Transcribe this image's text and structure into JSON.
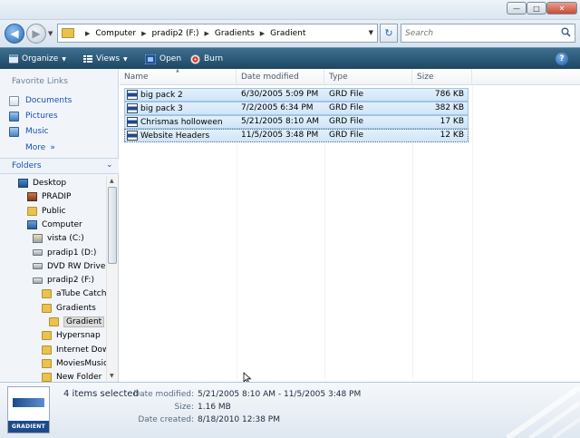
{
  "address": {
    "crumbs": [
      "Computer",
      "pradip2 (F:)",
      "Gradients",
      "Gradient"
    ],
    "search_placeholder": "Search"
  },
  "toolbar": {
    "organize_label": "Organize",
    "views_label": "Views",
    "open_label": "Open",
    "burn_label": "Burn"
  },
  "nav": {
    "favorite_heading": "Favorite Links",
    "favorites": [
      "Documents",
      "Pictures",
      "Music"
    ],
    "more_label": "More",
    "folders_heading": "Folders",
    "tree": [
      {
        "label": "Desktop",
        "icon": "desktop-icon"
      },
      {
        "label": "PRADIP",
        "icon": "user-folder-icon"
      },
      {
        "label": "Public",
        "icon": "folder-icon"
      },
      {
        "label": "Computer",
        "icon": "computer-icon"
      },
      {
        "label": "vista (C:)",
        "icon": "drive-icon"
      },
      {
        "label": "pradip1 (D:)",
        "icon": "drive-icon"
      },
      {
        "label": "DVD RW Drive",
        "icon": "dvd-drive-icon"
      },
      {
        "label": "pradip2 (F:)",
        "icon": "drive-icon"
      },
      {
        "label": "aTube Catch",
        "icon": "folder-icon"
      },
      {
        "label": "Gradients",
        "icon": "folder-icon"
      },
      {
        "label": "Gradient",
        "icon": "folder-icon",
        "selected": true
      },
      {
        "label": "Hypersnap",
        "icon": "folder-icon"
      },
      {
        "label": "Internet Dow",
        "icon": "folder-icon"
      },
      {
        "label": "MoviesMusic",
        "icon": "folder-icon"
      },
      {
        "label": "New Folder",
        "icon": "folder-icon"
      }
    ]
  },
  "columns": {
    "name": "Name",
    "date": "Date modified",
    "type": "Type",
    "size": "Size"
  },
  "files": [
    {
      "name": "big pack 2",
      "date": "6/30/2005 5:09 PM",
      "type": "GRD File",
      "size": "786 KB"
    },
    {
      "name": "big pack 3",
      "date": "7/2/2005 6:34 PM",
      "type": "GRD File",
      "size": "382 KB"
    },
    {
      "name": "Chrismas holloween",
      "date": "5/21/2005 8:10 AM",
      "type": "GRD File",
      "size": "17 KB"
    },
    {
      "name": "Website Headers",
      "date": "11/5/2005 3:48 PM",
      "type": "GRD File",
      "size": "12 KB"
    }
  ],
  "details": {
    "thumbnail_label": "GRADIENT",
    "selected_count": "4 items selected",
    "date_modified_label": "Date modified:",
    "date_modified_value": "5/21/2005 8:10 AM - 11/5/2005 3:48 PM",
    "size_label": "Size:",
    "size_value": "1.16 MB",
    "date_created_label": "Date created:",
    "date_created_value": "8/18/2010 12:38 PM"
  }
}
